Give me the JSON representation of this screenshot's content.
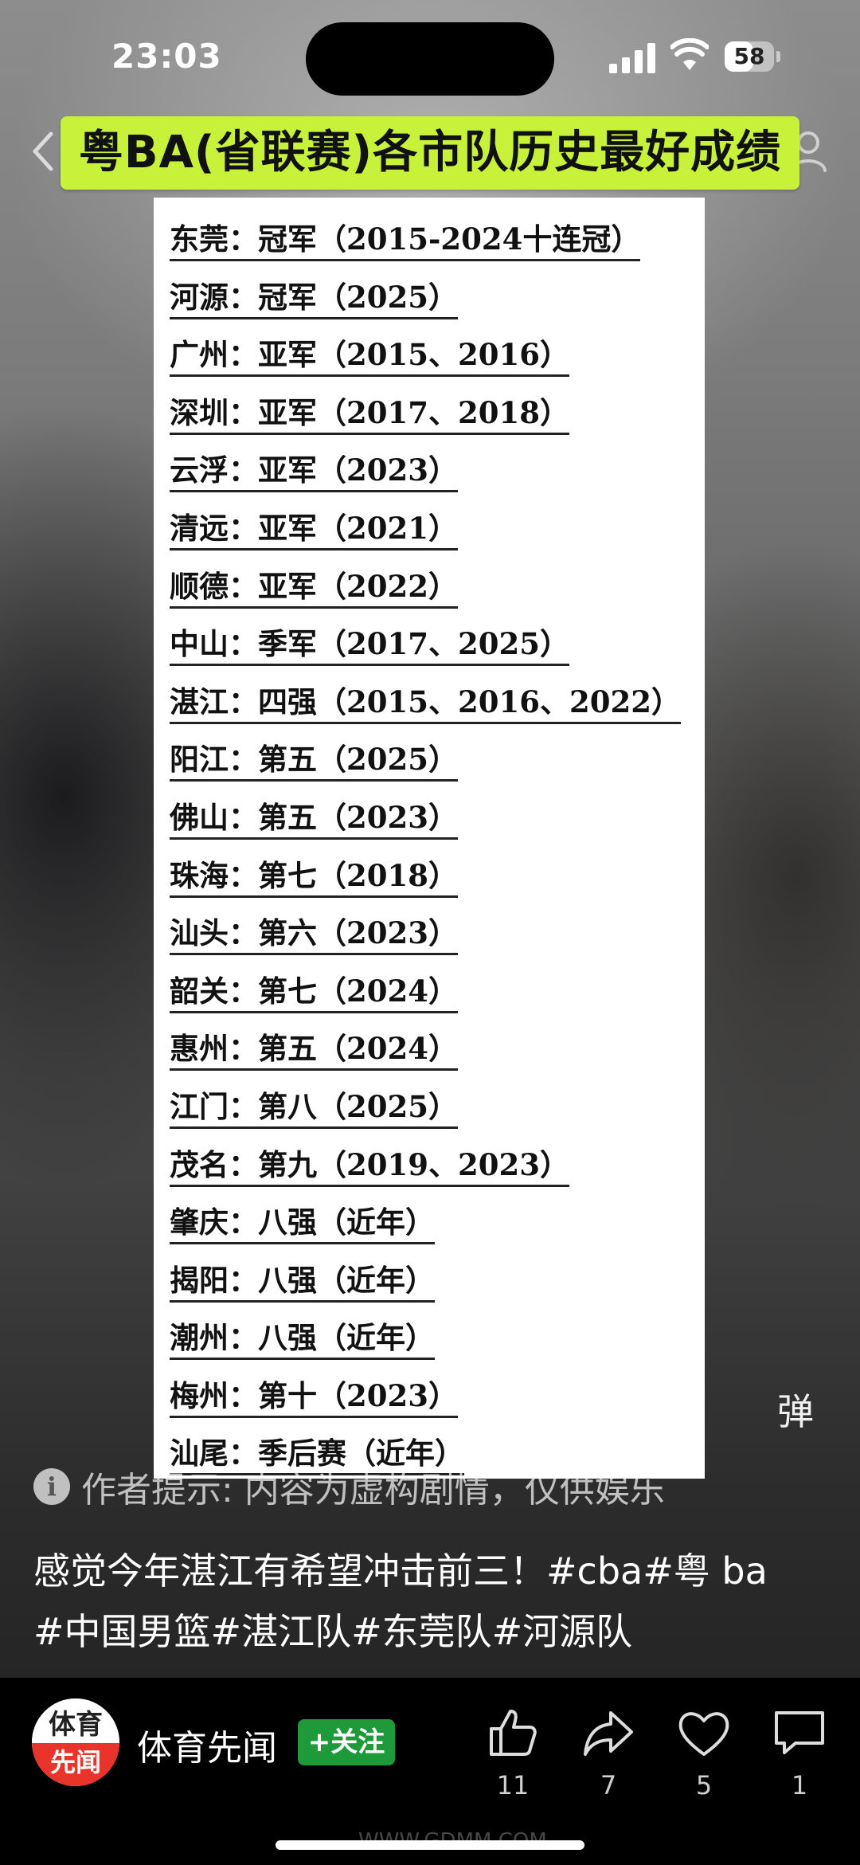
{
  "status_bar": {
    "time": "23:03",
    "battery": "58",
    "battery_level": 0.58
  },
  "post": {
    "title": "粤BA(省联赛)各市队历史最好成绩",
    "results": [
      "东莞：冠军（2015-2024十连冠）",
      "河源：冠军（2025）",
      "广州：亚军（2015、2016）",
      "深圳：亚军（2017、2018）",
      "云浮：亚军（2023）",
      "清远：亚军（2021）",
      "顺德：亚军（2022）",
      "中山：季军（2017、2025）",
      "湛江：四强（2015、2016、2022）",
      "阳江：第五（2025）",
      "佛山：第五（2023）",
      "珠海：第七（2018）",
      "汕头：第六（2023）",
      "韶关：第七（2024）",
      "惠州：第五（2024）",
      "江门：第八（2025）",
      "茂名：第九（2019、2023）",
      "肇庆：八强（近年）",
      "揭阳：八强（近年）",
      "潮州：八强（近年）",
      "梅州：第十（2023）",
      "汕尾：季后赛（近年）"
    ]
  },
  "danmu_label": "弹",
  "notice": "作者提示: 内容为虚构剧情，仅供娱乐",
  "caption_lines": [
    "感觉今年湛江有希望冲击前三！#cba#粤 ba",
    "#中国男篮#湛江队#东莞队#河源队"
  ],
  "author": {
    "avatar_top": "体育",
    "avatar_bottom": "先闻",
    "name": "体育先闻",
    "follow_label": "+关注"
  },
  "actions": [
    {
      "icon": "thumbs-up-icon",
      "count": "11"
    },
    {
      "icon": "share-icon",
      "count": "7"
    },
    {
      "icon": "heart-icon",
      "count": "5"
    },
    {
      "icon": "comment-icon",
      "count": "1"
    }
  ],
  "watermark": "WWW.GDMM.COM"
}
